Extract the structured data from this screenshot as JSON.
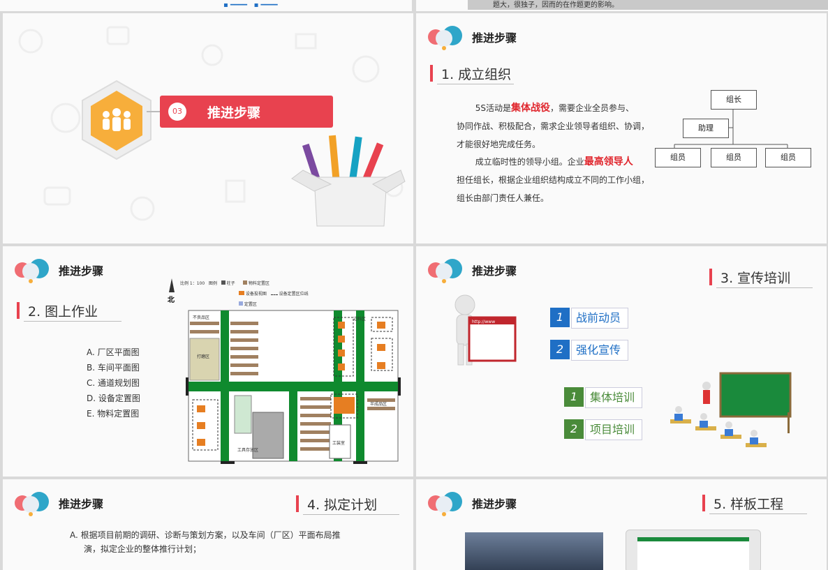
{
  "top_strip": {
    "left_text": "",
    "right_text": "题大，很独子，因而的在作题更的影响。"
  },
  "slide_cover": {
    "number": "03",
    "title": "推进步骤"
  },
  "slide_org": {
    "header": "推进步骤",
    "section": "1. 成立组织",
    "para1_a": "5S活动是",
    "para1_red": "集体战役",
    "para1_b": "，需要企业全员参与、",
    "para1_line2": "协同作战、积极配合，需求企业领导者组织、协调，",
    "para1_line3": "才能很好地完成任务。",
    "para2_a": "成立临时性的领导小组。企业",
    "para2_red": "最高领导人",
    "para2_line2": "担任组长，根据企业组织结构成立不同的工作小组，",
    "para2_line3": "组长由部门责任人兼任。",
    "org": {
      "leader": "组长",
      "assistant": "助理",
      "member1": "组员",
      "member2": "组员",
      "member3": "组员"
    }
  },
  "slide_map": {
    "header": "推进步骤",
    "section": "2. 图上作业",
    "items": [
      "A.  厂区平面图",
      "B.  车间平面图",
      "C.  通道规划图",
      "D.  设备定置图",
      "E.  物料定置图"
    ],
    "legend": {
      "scale": "比例  1：100",
      "legend_label": "图例",
      "pillar": "柱子",
      "material": "物料定置区",
      "equip": "设备投视图",
      "line": "设备定置区位线",
      "fixed": "定置区"
    },
    "north": "北",
    "areas": {
      "bad": "不良品区",
      "print": "打磨区",
      "mat": "待料区",
      "office": "工装室",
      "finished": "半成品区",
      "waste": "边料区",
      "tool": "工具存放区",
      "mat2": "物料暂放区"
    }
  },
  "slide_training": {
    "header": "推进步骤",
    "section": "3. 宣传培训",
    "board": "http://www",
    "tags_blue": [
      {
        "num": "1",
        "label": "战前动员"
      },
      {
        "num": "2",
        "label": "强化宣传"
      }
    ],
    "tags_green": [
      {
        "num": "1",
        "label": "集体培训"
      },
      {
        "num": "2",
        "label": "项目培训"
      }
    ]
  },
  "slide_plan": {
    "header": "推进步骤",
    "section": "4. 拟定计划",
    "item_a_line1": "A.   根据项目前期的调研、诊断与策划方案，以及车间（厂区）平面布局推",
    "item_a_line2": "演，拟定企业的整体推行计划；"
  },
  "slide_model": {
    "header": "推进步骤",
    "section": "5. 样板工程"
  },
  "colors": {
    "accent_red": "#e8424f",
    "blue": "#1f6fc5",
    "green": "#4a8b3a",
    "aisle_green": "#0f8a2e",
    "hex_orange": "#f7ae3b"
  }
}
